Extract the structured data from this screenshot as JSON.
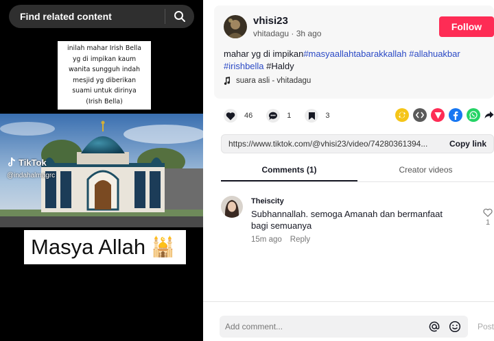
{
  "search": {
    "placeholder": "Find related content"
  },
  "video": {
    "caption_lines": [
      "inilah mahar Irish Bella",
      "yg di impikan kaum",
      "wanita sungguh indah",
      "mesjid yg diberikan",
      "suami untuk dirinya",
      "(Irish Bella)"
    ],
    "watermark_brand": "TikTok",
    "watermark_user": "@indahalmagrc",
    "overlay_text": "Masya Allah",
    "overlay_emoji": "🕌"
  },
  "post": {
    "author": "vhisi23",
    "meta": "vhitadagu · 3h ago",
    "follow_label": "Follow",
    "desc_text": "mahar yg di impikan",
    "hashtags": [
      "#masyaallahtabarakkallah",
      "#allahuakbar",
      "#irishbella"
    ],
    "desc_tail": "#Haldy",
    "sound": "suara asli - vhitadagu"
  },
  "stats": {
    "likes": "46",
    "comments": "1",
    "saves": "3"
  },
  "share_colors": {
    "repost": "#f5c518",
    "embed": "#5a5a5a",
    "send": "#fe2c55",
    "facebook": "#1877f2",
    "whatsapp": "#25d366"
  },
  "link": {
    "url": "https://www.tiktok.com/@vhisi23/video/74280361394...",
    "copy_label": "Copy link"
  },
  "tabs": [
    {
      "label": "Comments (1)"
    },
    {
      "label": "Creator videos"
    }
  ],
  "comment": {
    "user": "Theiscity",
    "text": "Subhannallah. semoga Amanah dan bermanfaat bagi semuanya",
    "time": "15m ago",
    "reply_label": "Reply",
    "likes": "1"
  },
  "composer": {
    "placeholder": "Add comment...",
    "post_label": "Post"
  }
}
